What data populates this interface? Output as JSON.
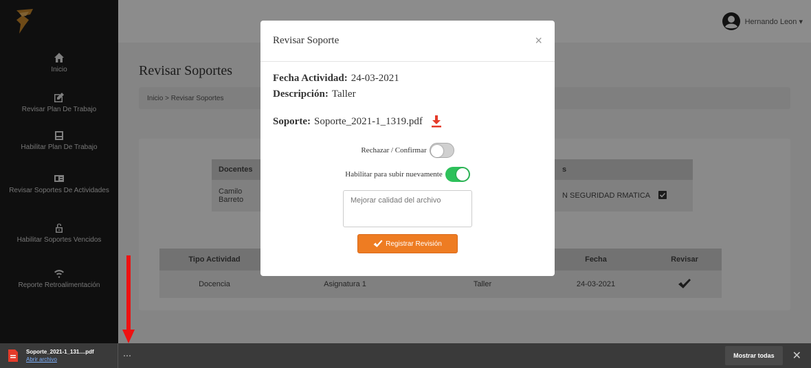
{
  "colors": {
    "accent": "#ee7c22",
    "toggle_on": "#2ec15b",
    "annotation": "#ee1111"
  },
  "logo": {
    "text": ""
  },
  "user": {
    "name": "Hernando Leon ▾",
    "icon": "user-circle-icon"
  },
  "sidebar": {
    "items": [
      {
        "label": "Inicio",
        "icon": "home-icon"
      },
      {
        "label": "Revisar Plan De Trabajo",
        "icon": "edit-square-icon"
      },
      {
        "label": "Habilitar Plan De Trabajo",
        "icon": "clipboard-icon"
      },
      {
        "label": "Revisar Soportes De Actividades",
        "icon": "id-card-icon"
      },
      {
        "label": "Habilitar Soportes Vencidos",
        "icon": "unlock-icon"
      },
      {
        "label": "Reporte Retroalimentación",
        "icon": "wifi-icon"
      }
    ]
  },
  "page": {
    "title": "Revisar Soportes",
    "breadcrumb": "Inicio > Revisar Soportes"
  },
  "docentes_table": {
    "headers": [
      "Docentes",
      "",
      "",
      "s",
      ""
    ],
    "row": [
      "Camilo Barreto",
      "",
      "",
      "N SEGURIDAD RMATICA",
      ""
    ]
  },
  "activities_table": {
    "headers": [
      "Tipo Actividad",
      "",
      "",
      "Fecha",
      "Revisar"
    ],
    "rows": [
      [
        "Docencia",
        "Asignatura 1",
        "Taller",
        "24-03-2021",
        ""
      ]
    ]
  },
  "modal": {
    "title": "Revisar Soporte",
    "close": "×",
    "fecha_label": "Fecha Actividad:",
    "fecha_value": "24-03-2021",
    "desc_label": "Descripción:",
    "desc_value": "Taller",
    "soporte_label": "Soporte:",
    "soporte_value": "Soporte_2021-1_1319.pdf",
    "toggle1_label": "Rechazar / Confirmar",
    "toggle1_on": false,
    "toggle2_label": "Habilitar para subir nuevamente",
    "toggle2_on": true,
    "textarea_value": "Mejorar calidad del archivo",
    "register_label": "Registrar Revisión"
  },
  "download_bar": {
    "file_name": "Soporte_2021-1_131....pdf",
    "open_label": "Abrir archivo",
    "more": "⋯",
    "show_all": "Mostrar todas",
    "close": "✕"
  }
}
